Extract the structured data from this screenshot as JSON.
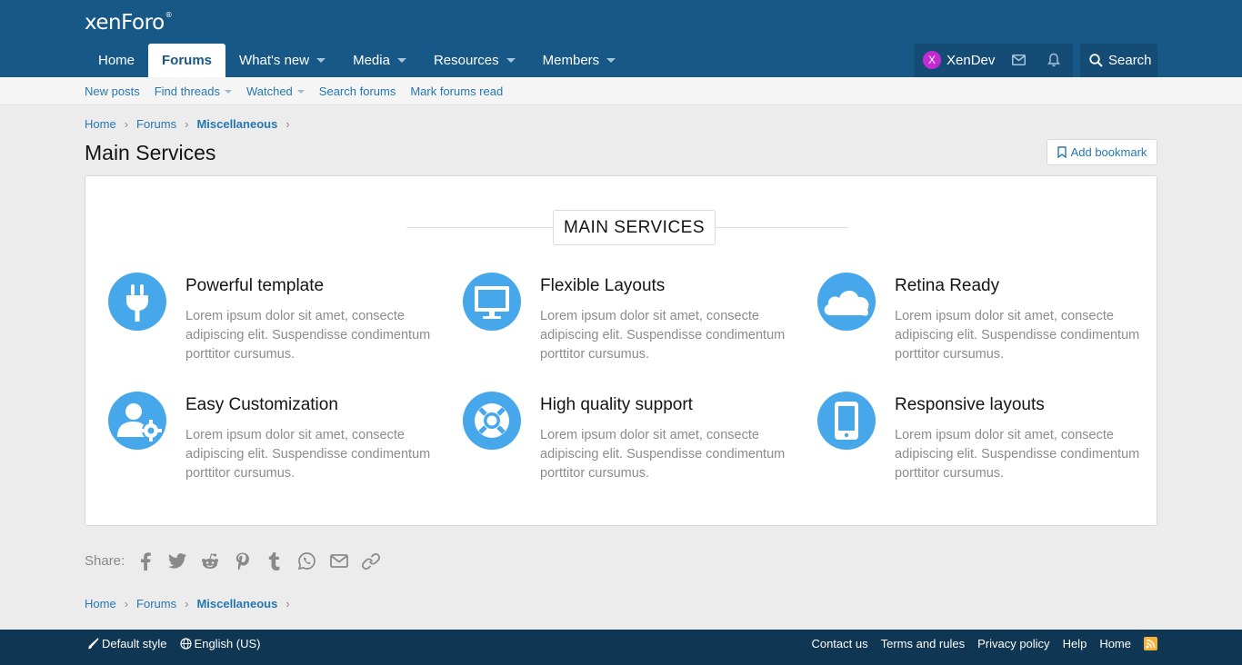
{
  "header": {
    "logo_text": "xenForo",
    "logo_mark": "®",
    "tabs": [
      {
        "label": "Home",
        "has_menu": false,
        "active": false
      },
      {
        "label": "Forums",
        "has_menu": false,
        "active": true
      },
      {
        "label": "What's new",
        "has_menu": true,
        "active": false
      },
      {
        "label": "Media",
        "has_menu": true,
        "active": false
      },
      {
        "label": "Resources",
        "has_menu": true,
        "active": false
      },
      {
        "label": "Members",
        "has_menu": true,
        "active": false
      }
    ],
    "user": {
      "avatar_letter": "X",
      "name": "XenDev"
    },
    "search_label": "Search"
  },
  "subnav": [
    {
      "label": "New posts",
      "has_menu": false
    },
    {
      "label": "Find threads",
      "has_menu": true
    },
    {
      "label": "Watched",
      "has_menu": true
    },
    {
      "label": "Search forums",
      "has_menu": false
    },
    {
      "label": "Mark forums read",
      "has_menu": false
    }
  ],
  "breadcrumb": [
    {
      "label": "Home",
      "strong": false
    },
    {
      "label": "Forums",
      "strong": false
    },
    {
      "label": "Miscellaneous",
      "strong": true
    }
  ],
  "page": {
    "title": "Main Services",
    "bookmark_label": "Add bookmark"
  },
  "services_section": {
    "heading": "MAIN SERVICES",
    "items": [
      {
        "title": "Powerful template",
        "text": "Lorem ipsum dolor sit amet, consecte adipiscing elit. Suspendisse condimentum porttitor cursumus.",
        "icon": "plug-icon"
      },
      {
        "title": "Flexible Layouts",
        "text": "Lorem ipsum dolor sit amet, consecte adipiscing elit. Suspendisse condimentum porttitor cursumus.",
        "icon": "monitor-icon"
      },
      {
        "title": "Retina Ready",
        "text": "Lorem ipsum dolor sit amet, consecte adipiscing elit. Suspendisse condimentum porttitor cursumus.",
        "icon": "cloud-icon"
      },
      {
        "title": "Easy Customization",
        "text": "Lorem ipsum dolor sit amet, consecte adipiscing elit. Suspendisse condimentum porttitor cursumus.",
        "icon": "user-gear-icon"
      },
      {
        "title": "High quality support",
        "text": "Lorem ipsum dolor sit amet, consecte adipiscing elit. Suspendisse condimentum porttitor cursumus.",
        "icon": "lifebuoy-icon"
      },
      {
        "title": "Responsive layouts",
        "text": "Lorem ipsum dolor sit amet, consecte adipiscing elit. Suspendisse condimentum porttitor cursumus.",
        "icon": "mobile-icon"
      }
    ]
  },
  "share": {
    "label": "Share:",
    "icons": [
      "facebook-icon",
      "twitter-icon",
      "reddit-icon",
      "pinterest-icon",
      "tumblr-icon",
      "whatsapp-icon",
      "email-icon",
      "link-icon"
    ]
  },
  "footer": {
    "style_label": "Default style",
    "language_label": "English (US)",
    "links": [
      "Contact us",
      "Terms and rules",
      "Privacy policy",
      "Help",
      "Home"
    ]
  },
  "colors": {
    "header_bg": "#185886",
    "accent_link": "#2577b1",
    "icon_circle": "#47a7eb",
    "footer_bg": "#0f3652",
    "rss": "#f7b13b",
    "avatar": "#c42ad1"
  }
}
